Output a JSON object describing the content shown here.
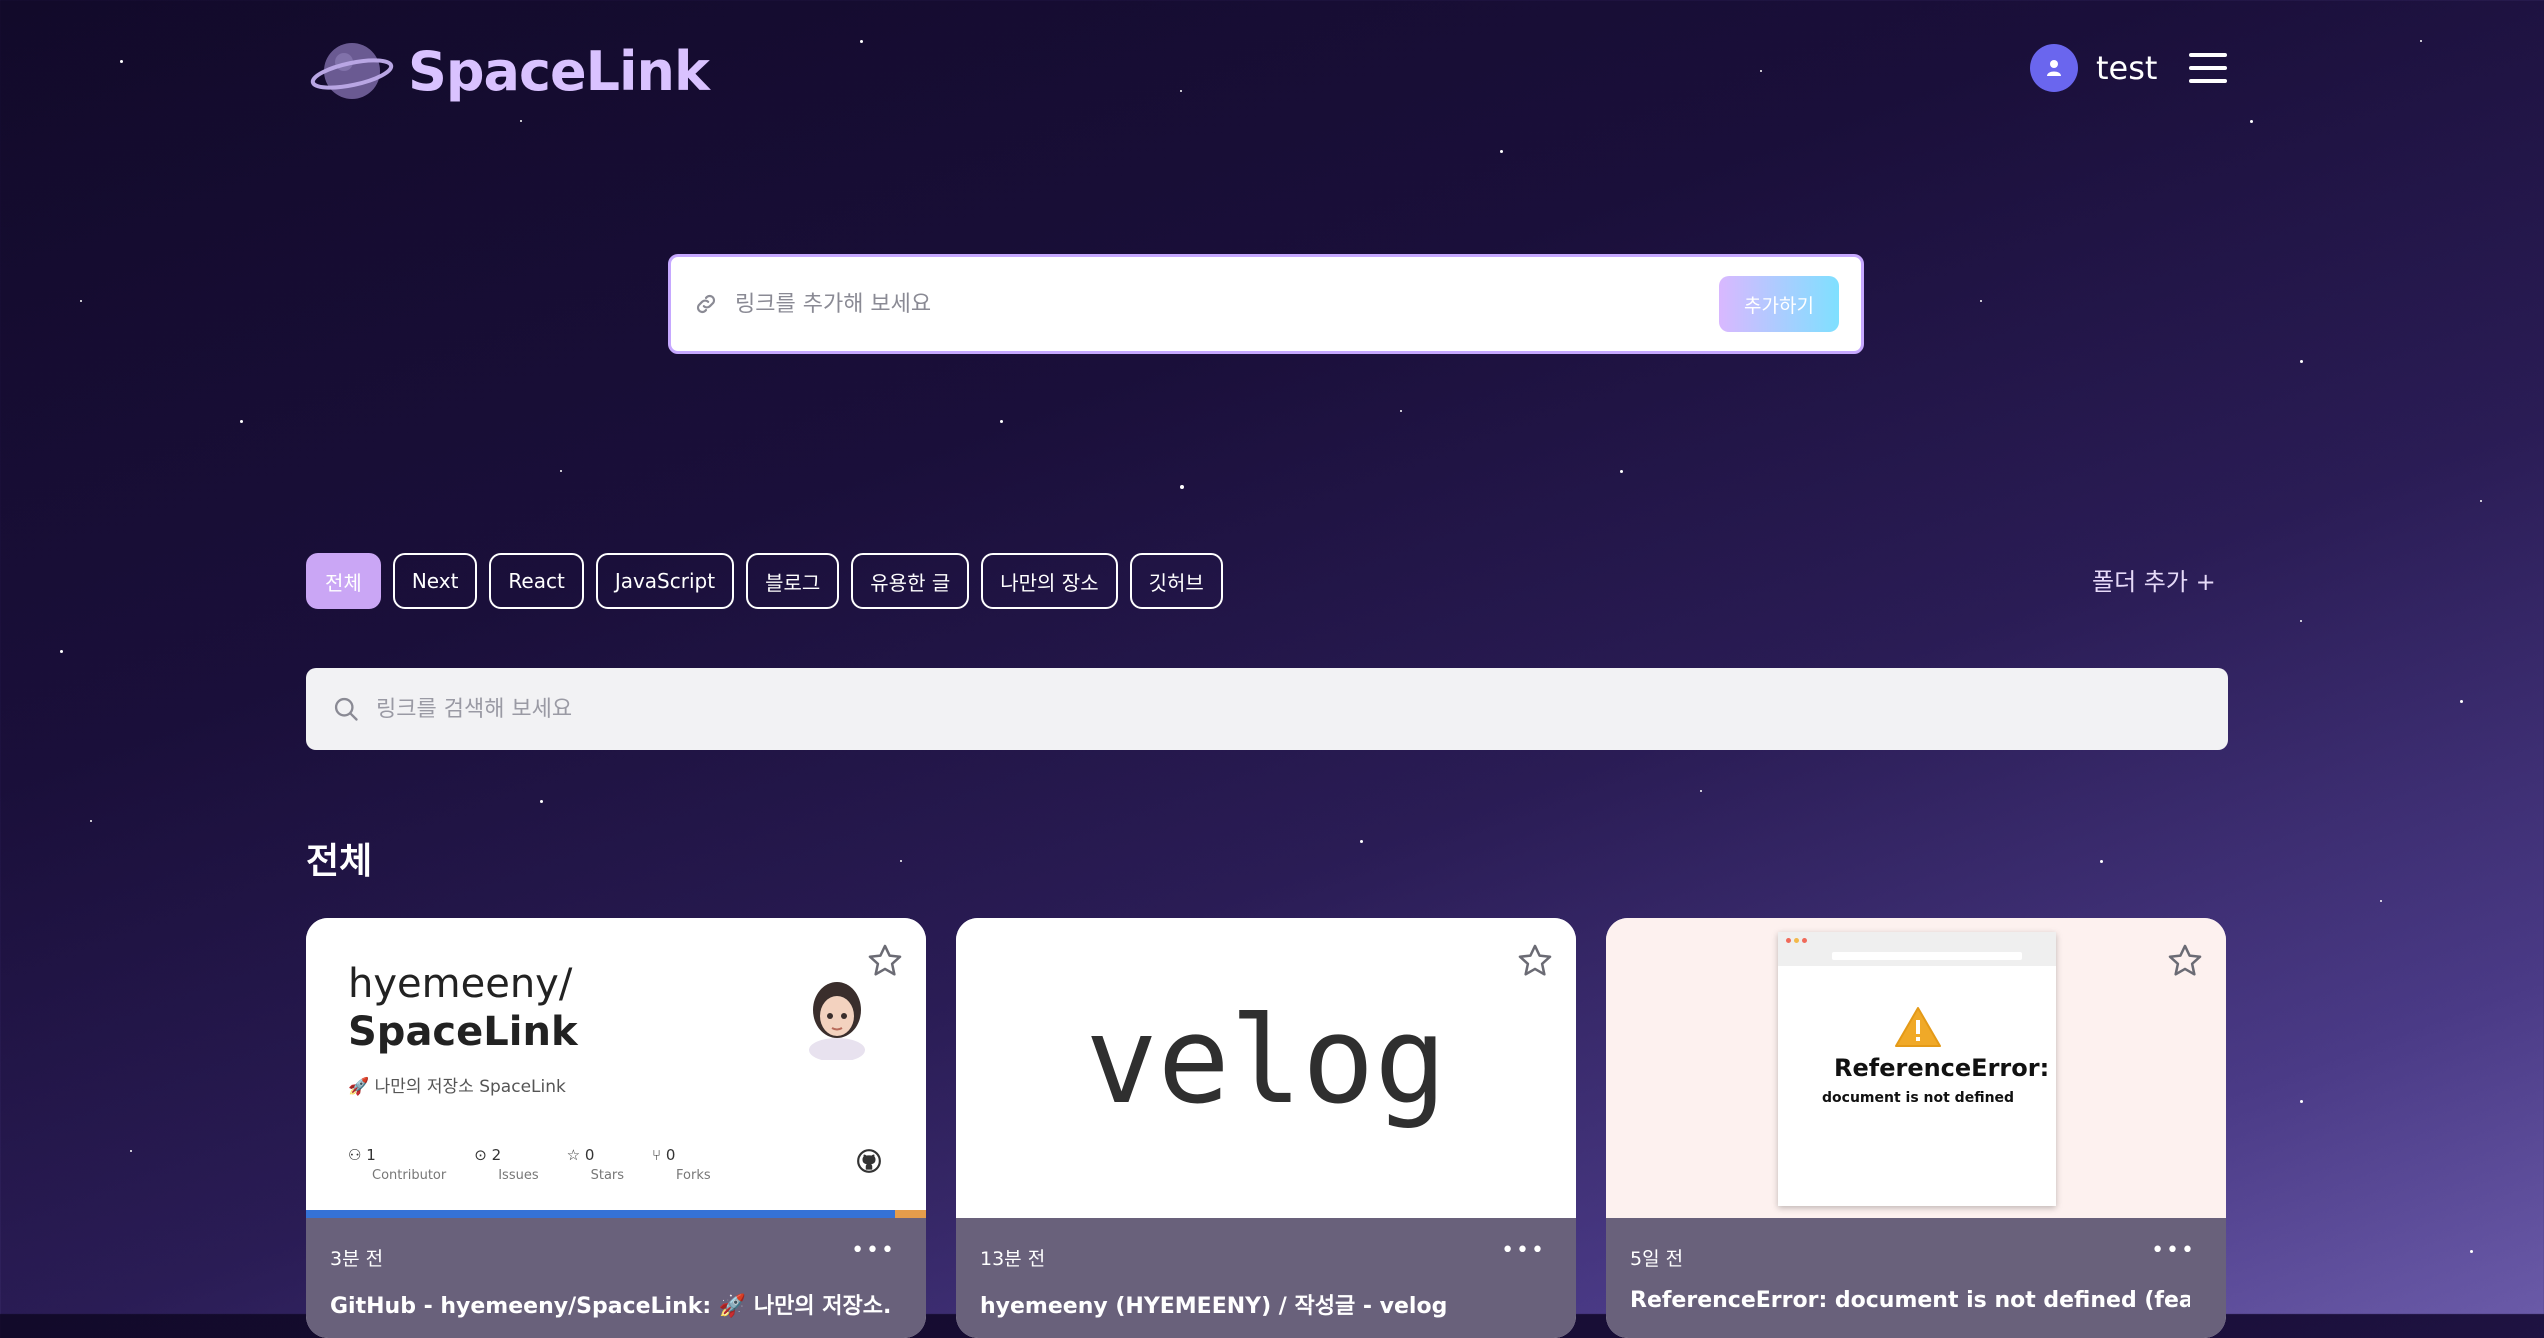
{
  "app": {
    "logo_text": "SpaceLink",
    "user_name": "test"
  },
  "add_link": {
    "placeholder": "링크를 추가해 보세요",
    "button_label": "추가하기"
  },
  "folders": {
    "items": [
      "전체",
      "Next",
      "React",
      "JavaScript",
      "블로그",
      "유용한 글",
      "나만의 장소",
      "깃허브"
    ],
    "active": "전체",
    "add_label": "폴더 추가 +"
  },
  "search": {
    "placeholder": "링크를 검색해 보세요"
  },
  "section": {
    "title": "전체"
  },
  "cards": [
    {
      "time": "3분 전",
      "title": "GitHub - hyemeeny/SpaceLink: 🚀 나만의 저장소...",
      "thumb": {
        "repo_owner": "hyemeeny/",
        "repo_name": "SpaceLink",
        "description": "🚀 나만의 저장소 SpaceLink",
        "stats": [
          {
            "value": "1",
            "label": "Contributor"
          },
          {
            "value": "2",
            "label": "Issues"
          },
          {
            "value": "0",
            "label": "Stars"
          },
          {
            "value": "0",
            "label": "Forks"
          }
        ]
      }
    },
    {
      "time": "13분 전",
      "title": "hyemeeny (HYEMEENY) / 작성글 - velog",
      "thumb": {
        "text": "velog"
      }
    },
    {
      "time": "5일 전",
      "title": "ReferenceError: document is not defined (feat....",
      "thumb": {
        "error_title": "ReferenceError:",
        "error_sub": "document is not defined"
      }
    }
  ],
  "colors": {
    "accent": "#caa6f5",
    "logo": "#d9c2ff",
    "avatar": "#6a66ee"
  }
}
